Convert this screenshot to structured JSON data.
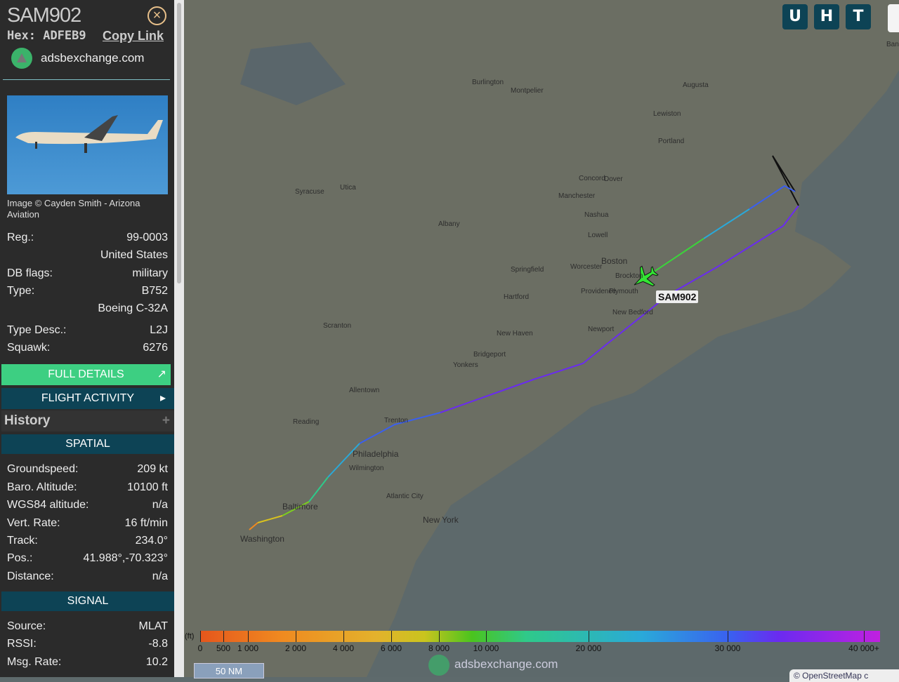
{
  "header": {
    "callsign": "SAM902",
    "hex_label": "Hex:",
    "hex": "ADFEB9",
    "copy_link": "Copy Link",
    "site": "adsbexchange.com"
  },
  "photo": {
    "credit": "Image © Cayden Smith - Arizona Aviation"
  },
  "details": [
    {
      "label": "Reg.:",
      "value": "99-0003"
    },
    {
      "label": "",
      "value": "United States"
    },
    {
      "label": "DB flags:",
      "value": "military"
    },
    {
      "label": "Type:",
      "value": "B752"
    },
    {
      "label": "",
      "value": "Boeing C-32A"
    },
    {
      "label": "Type Desc.:",
      "value": "L2J"
    },
    {
      "label": "Squawk:",
      "value": "6276"
    }
  ],
  "buttons": {
    "full_details": "FULL DETAILS",
    "flight_activity": "FLIGHT ACTIVITY",
    "history": "History"
  },
  "spatial": {
    "title": "SPATIAL",
    "rows": [
      {
        "label": "Groundspeed:",
        "value": "209 kt"
      },
      {
        "label": "Baro. Altitude:",
        "value": "10100 ft"
      },
      {
        "label": "WGS84 altitude:",
        "value": "n/a"
      },
      {
        "label": "Vert. Rate:",
        "value": "16 ft/min"
      },
      {
        "label": "Track:",
        "value": "234.0°"
      },
      {
        "label": "Pos.:",
        "value": "41.988°,-70.323°"
      },
      {
        "label": "Distance:",
        "value": "n/a"
      }
    ]
  },
  "signal": {
    "title": "SIGNAL",
    "rows": [
      {
        "label": "Source:",
        "value": "MLAT"
      },
      {
        "label": "RSSI:",
        "value": "-8.8"
      },
      {
        "label": "Msg. Rate:",
        "value": "10.2"
      }
    ]
  },
  "map": {
    "buttons": [
      "U",
      "H",
      "T"
    ],
    "aircraft_label": "SAM902",
    "scale": "50 NM",
    "watermark": "adsbexchange.com",
    "attribution": "© OpenStreetMap c",
    "places": [
      "Boston",
      "New York",
      "Philadelphia",
      "Baltimore",
      "Washington",
      "Providence",
      "Hartford",
      "Albany",
      "Portland",
      "Concord",
      "Worcester",
      "Newport",
      "New Haven",
      "Trenton",
      "Syracuse",
      "Burlington",
      "Plymouth",
      "New Bedford",
      "Atlantic City",
      "Brockton",
      "Springfield",
      "Utica",
      "Montpelier",
      "Augusta",
      "Bangor",
      "Lewiston",
      "Dover",
      "Nashua",
      "Lowell",
      "Manchester",
      "Scranton",
      "Allentown",
      "Reading",
      "Wilmington",
      "Yonkers",
      "Bridgeport"
    ]
  },
  "legend": {
    "unit": "(ft)",
    "ticks": [
      "0",
      "500",
      "1 000",
      "2 000",
      "4 000",
      "6 000",
      "8 000",
      "10 000",
      "20 000",
      "30 000",
      "40 000+"
    ]
  }
}
